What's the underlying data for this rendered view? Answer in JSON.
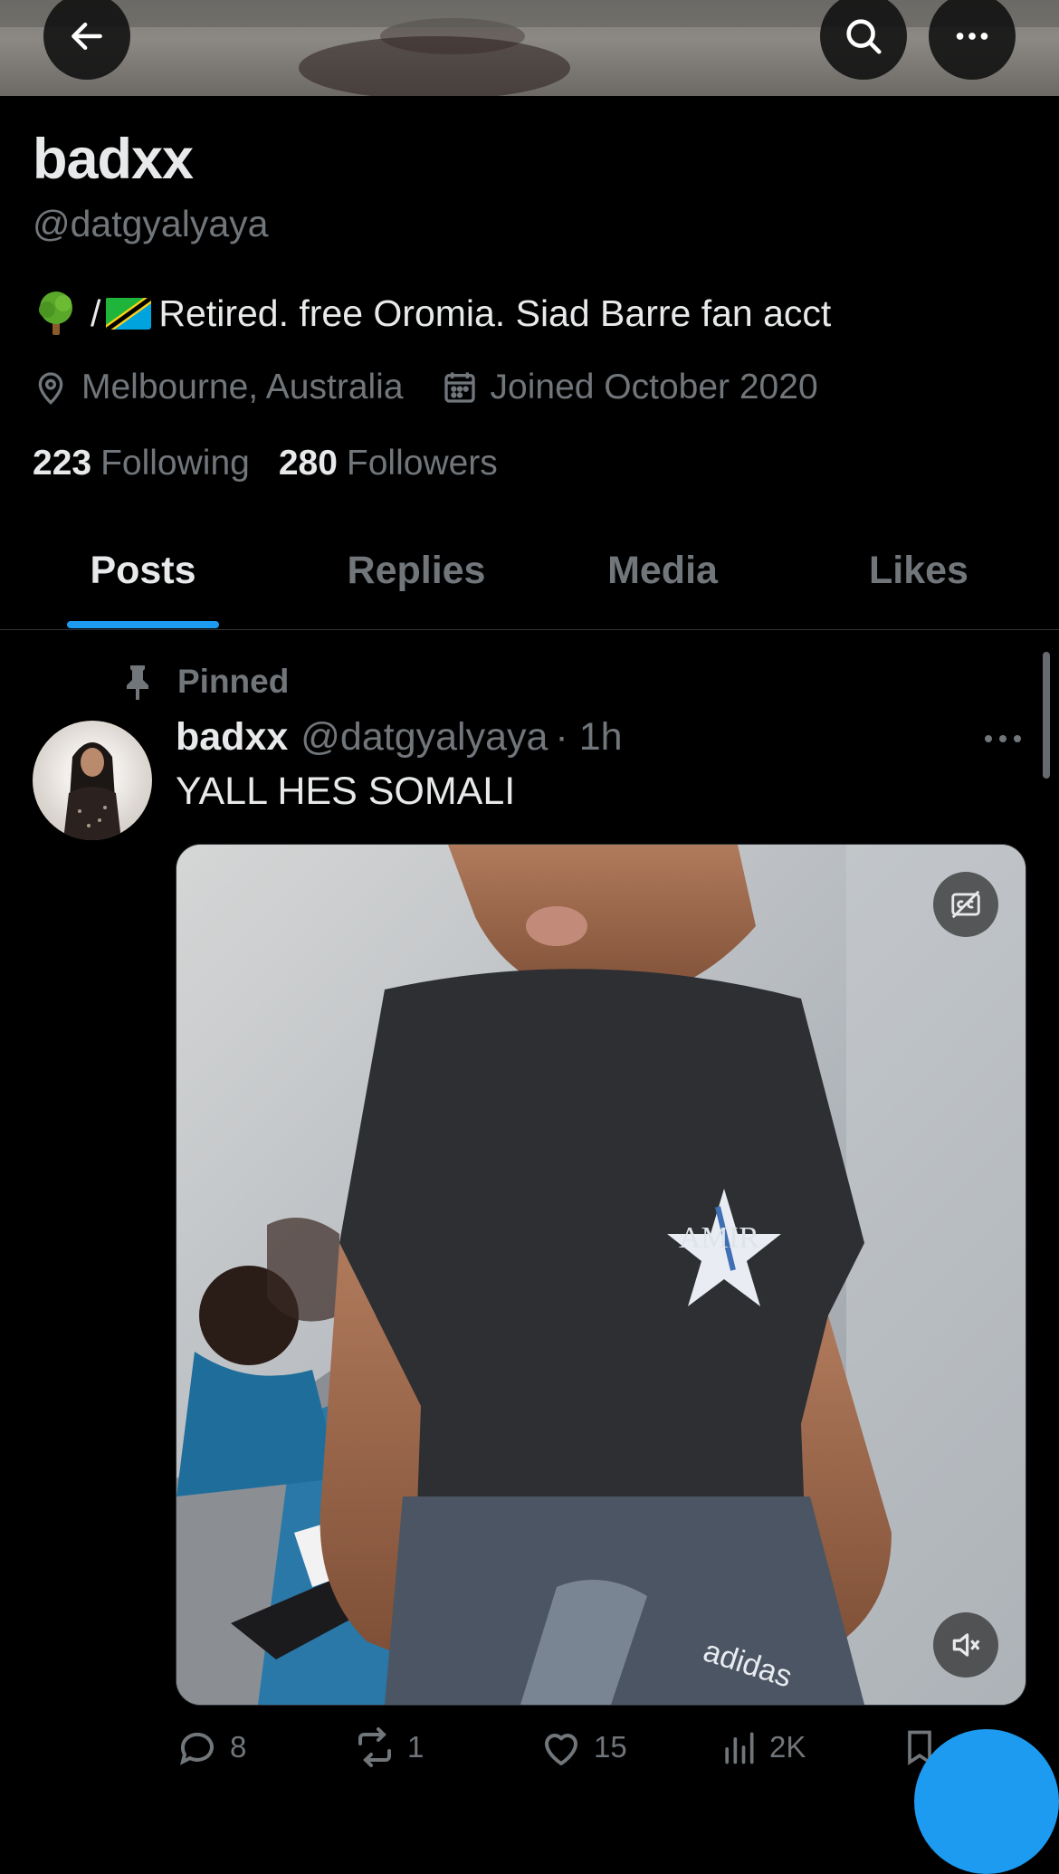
{
  "profile": {
    "name": "badxx",
    "handle": "@datgyalyaya",
    "bio_slash": "/",
    "bio_text": "Retired. free Oromia. Siad Barre fan acct",
    "location": "Melbourne, Australia",
    "joined": "Joined October 2020",
    "following_count": "223",
    "following_label": "Following",
    "followers_count": "280",
    "followers_label": "Followers"
  },
  "tabs": [
    {
      "label": "Posts",
      "active": true
    },
    {
      "label": "Replies",
      "active": false
    },
    {
      "label": "Media",
      "active": false
    },
    {
      "label": "Likes",
      "active": false
    }
  ],
  "post": {
    "pinned_label": "Pinned",
    "author": "badxx",
    "handle": "@datgyalyaya",
    "time": "· 1h",
    "text": "YALL HES SOMALI",
    "media_print": "AMIR",
    "media_brand": "adidas",
    "replies": "8",
    "reposts": "1",
    "likes": "15",
    "views": "2K"
  },
  "icons": {
    "back": "arrow-left-icon",
    "search": "search-icon",
    "more": "more-horizontal-icon",
    "location": "location-pin-icon",
    "calendar": "calendar-icon",
    "pin": "pin-icon",
    "captions": "captions-off-icon",
    "mute": "speaker-muted-icon",
    "reply": "reply-icon",
    "repost": "repost-icon",
    "like": "heart-icon",
    "views": "views-chart-icon",
    "bookmark": "bookmark-icon",
    "share": "share-icon"
  },
  "colors": {
    "background": "#000000",
    "text": "#e7e9ea",
    "muted": "#71767b",
    "accent": "#1d9bf0",
    "divider": "#2f3336"
  }
}
